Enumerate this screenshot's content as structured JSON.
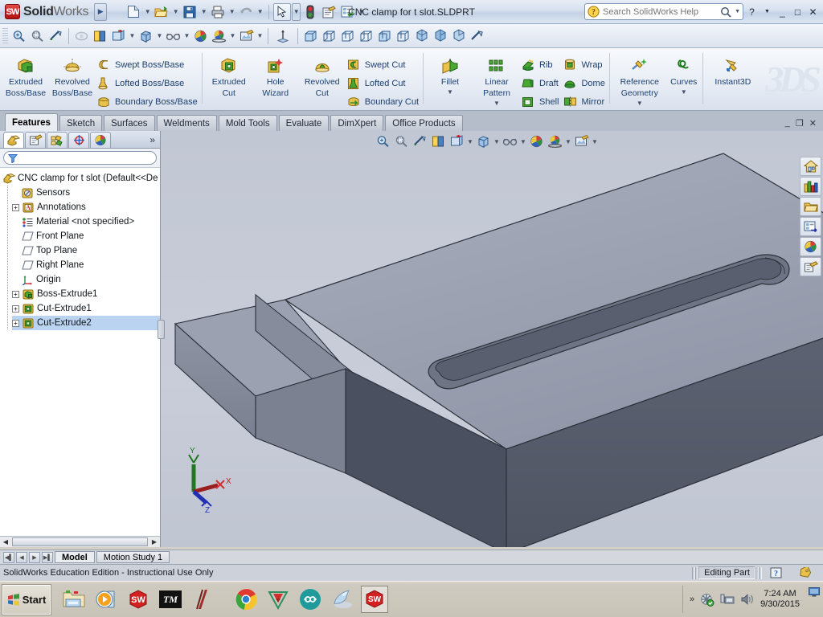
{
  "titlebar": {
    "brand_bold": "Solid",
    "brand_light": "Works",
    "brand_badge": "SW",
    "document_title": "CNC clamp for t slot.SLDPRT",
    "quick_access": [
      {
        "name": "new-document-icon",
        "label": "New"
      },
      {
        "name": "open-document-icon",
        "label": "Open"
      },
      {
        "name": "save-icon",
        "label": "Save"
      },
      {
        "name": "print-icon",
        "label": "Print"
      },
      {
        "name": "undo-icon",
        "label": "Undo"
      },
      {
        "name": "select-pointer-icon",
        "label": "Select"
      },
      {
        "name": "rebuild-icon",
        "label": "Rebuild"
      },
      {
        "name": "options-icon",
        "label": "Options"
      },
      {
        "name": "settings-list-icon",
        "label": "Settings"
      }
    ],
    "search_placeholder": "Search SolidWorks Help",
    "search_value": "",
    "help_label": "?",
    "minimize_label": "_",
    "maximize_label": "□",
    "close_label": "✕"
  },
  "view_toolbar": {
    "items": [
      {
        "name": "zoom-to-fit-icon",
        "label": "Zoom to Fit"
      },
      {
        "name": "zoom-to-area-icon",
        "label": "Zoom to Area"
      },
      {
        "name": "previous-view-icon",
        "label": "Previous View"
      },
      {
        "name": "section-view-icon",
        "label": "Section View"
      },
      {
        "name": "view-orientation-icon",
        "label": "View Orientation"
      },
      {
        "name": "display-style-icon",
        "label": "Display Style"
      },
      {
        "name": "hide-show-items-icon",
        "label": "Hide/Show Items"
      },
      {
        "name": "edit-appearance-icon",
        "label": "Edit Appearance"
      },
      {
        "name": "apply-scene-icon",
        "label": "Apply Scene"
      },
      {
        "name": "view-settings-icon",
        "label": "View Settings"
      },
      {
        "name": "coordinate-triad-icon",
        "label": "Coordinate System"
      }
    ],
    "orientation_views": [
      {
        "name": "view-front-icon",
        "label": "Front"
      },
      {
        "name": "view-back-icon",
        "label": "Back"
      },
      {
        "name": "view-left-icon",
        "label": "Left"
      },
      {
        "name": "view-right-icon",
        "label": "Right"
      },
      {
        "name": "view-top-icon",
        "label": "Top"
      },
      {
        "name": "view-bottom-icon",
        "label": "Bottom"
      },
      {
        "name": "view-isometric-icon",
        "label": "Isometric"
      },
      {
        "name": "view-trimetric-icon",
        "label": "Trimetric"
      },
      {
        "name": "view-dimetric-icon",
        "label": "Dimetric"
      },
      {
        "name": "view-normal-to-icon",
        "label": "Normal To"
      }
    ]
  },
  "ribbon": {
    "groups": [
      {
        "name": "boss-base-group",
        "big": [
          {
            "label_line1": "Extruded",
            "label_line2": "Boss/Base",
            "icon": "extruded-boss-icon",
            "dropdown": false
          },
          {
            "label_line1": "Revolved",
            "label_line2": "Boss/Base",
            "icon": "revolved-boss-icon",
            "dropdown": false
          }
        ],
        "small": [
          {
            "label": "Swept Boss/Base",
            "icon": "swept-boss-icon"
          },
          {
            "label": "Lofted Boss/Base",
            "icon": "lofted-boss-icon"
          },
          {
            "label": "Boundary Boss/Base",
            "icon": "boundary-boss-icon"
          }
        ]
      },
      {
        "name": "cut-group",
        "big": [
          {
            "label_line1": "Extruded",
            "label_line2": "Cut",
            "icon": "extruded-cut-icon",
            "dropdown": false
          },
          {
            "label_line1": "Hole",
            "label_line2": "Wizard",
            "icon": "hole-wizard-icon",
            "dropdown": false
          },
          {
            "label_line1": "Revolved",
            "label_line2": "Cut",
            "icon": "revolved-cut-icon",
            "dropdown": false
          }
        ],
        "small": [
          {
            "label": "Swept Cut",
            "icon": "swept-cut-icon"
          },
          {
            "label": "Lofted Cut",
            "icon": "lofted-cut-icon"
          },
          {
            "label": "Boundary Cut",
            "icon": "boundary-cut-icon"
          }
        ]
      },
      {
        "name": "feature-group",
        "big": [
          {
            "label_line1": "Fillet",
            "label_line2": "",
            "icon": "fillet-icon",
            "dropdown": true
          },
          {
            "label_line1": "Linear",
            "label_line2": "Pattern",
            "icon": "linear-pattern-icon",
            "dropdown": true
          }
        ],
        "small": [
          {
            "label": "Rib",
            "icon": "rib-icon"
          },
          {
            "label": "Draft",
            "icon": "draft-icon"
          },
          {
            "label": "Shell",
            "icon": "shell-icon"
          }
        ],
        "small2": [
          {
            "label": "Wrap",
            "icon": "wrap-icon"
          },
          {
            "label": "Dome",
            "icon": "dome-icon"
          },
          {
            "label": "Mirror",
            "icon": "mirror-icon"
          }
        ]
      },
      {
        "name": "reference-group",
        "big": [
          {
            "label_line1": "Reference",
            "label_line2": "Geometry",
            "icon": "reference-geometry-icon",
            "dropdown": true
          },
          {
            "label_line1": "Curves",
            "label_line2": "",
            "icon": "curves-icon",
            "dropdown": true
          }
        ],
        "small": []
      },
      {
        "name": "instant3d-group",
        "big": [
          {
            "label_line1": "Instant3D",
            "label_line2": "",
            "icon": "instant3d-icon",
            "dropdown": false
          }
        ],
        "small": []
      }
    ],
    "brand_watermark": "3DS"
  },
  "command_tabs": {
    "items": [
      {
        "label": "Features",
        "active": true
      },
      {
        "label": "Sketch",
        "active": false
      },
      {
        "label": "Surfaces",
        "active": false
      },
      {
        "label": "Weldments",
        "active": false
      },
      {
        "label": "Mold Tools",
        "active": false
      },
      {
        "label": "Evaluate",
        "active": false
      },
      {
        "label": "DimXpert",
        "active": false
      },
      {
        "label": "Office Products",
        "active": false
      }
    ],
    "window_controls": {
      "minimize": "_",
      "restore": "❐",
      "close": "✕"
    }
  },
  "manager_panel": {
    "tabs": [
      {
        "name": "feature-manager-tab",
        "icon": "feature-tree-icon",
        "selected": true
      },
      {
        "name": "property-manager-tab",
        "icon": "property-manager-icon",
        "selected": false
      },
      {
        "name": "configuration-manager-tab",
        "icon": "configuration-manager-icon",
        "selected": false
      },
      {
        "name": "dimxpert-manager-tab",
        "icon": "dimxpert-icon",
        "selected": false
      },
      {
        "name": "display-manager-tab",
        "icon": "display-manager-icon",
        "selected": false
      }
    ],
    "more_label": "»",
    "filter_placeholder": "",
    "tree": {
      "root": "CNC clamp for t slot  (Default<<De",
      "nodes": [
        {
          "label": "Sensors",
          "icon": "sensors-icon",
          "expandable": false
        },
        {
          "label": "Annotations",
          "icon": "annotations-icon",
          "expandable": true
        },
        {
          "label": "Material <not specified>",
          "icon": "material-icon",
          "expandable": false
        },
        {
          "label": "Front Plane",
          "icon": "plane-icon",
          "expandable": false
        },
        {
          "label": "Top Plane",
          "icon": "plane-icon",
          "expandable": false
        },
        {
          "label": "Right Plane",
          "icon": "plane-icon",
          "expandable": false
        },
        {
          "label": "Origin",
          "icon": "origin-icon",
          "expandable": false
        },
        {
          "label": "Boss-Extrude1",
          "icon": "boss-extrude-icon",
          "expandable": true
        },
        {
          "label": "Cut-Extrude1",
          "icon": "cut-extrude-icon",
          "expandable": true
        },
        {
          "label": "Cut-Extrude2",
          "icon": "cut-extrude-icon",
          "expandable": true,
          "highlighted": true
        }
      ]
    }
  },
  "graphics_toolbar": {
    "items": [
      {
        "name": "zoom-to-fit-icon",
        "label": "Zoom to Fit"
      },
      {
        "name": "zoom-to-area-icon",
        "label": "Zoom to Area"
      },
      {
        "name": "previous-view-icon",
        "label": "Previous View"
      },
      {
        "name": "section-view-icon",
        "label": "Section View"
      },
      {
        "name": "view-orientation-icon",
        "label": "View Orientation"
      },
      {
        "name": "display-style-icon",
        "label": "Display Style"
      },
      {
        "name": "hide-show-items-icon",
        "label": "Hide/Show Items"
      },
      {
        "name": "edit-appearance-icon",
        "label": "Edit Appearance"
      },
      {
        "name": "apply-scene-icon",
        "label": "Apply Scene"
      },
      {
        "name": "view-settings-icon",
        "label": "View Settings"
      }
    ]
  },
  "task_pane": {
    "buttons": [
      {
        "name": "solidworks-resources-button",
        "icon": "home-icon",
        "label": "SolidWorks Resources"
      },
      {
        "name": "design-library-button",
        "icon": "design-library-icon",
        "label": "Design Library"
      },
      {
        "name": "file-explorer-button",
        "icon": "folder-icon",
        "label": "File Explorer"
      },
      {
        "name": "search-button",
        "icon": "search-panel-icon",
        "label": "Search"
      },
      {
        "name": "view-palette-button",
        "icon": "appearances-icon",
        "label": "Appearances, Scenes and Decals"
      },
      {
        "name": "custom-properties-button",
        "icon": "custom-properties-icon",
        "label": "Custom Properties"
      }
    ]
  },
  "model": {
    "axis_labels": {
      "x": "X",
      "y": "Y",
      "z": "Z"
    },
    "face_colors": {
      "top": "#9aa0b0",
      "front": "#5a6070",
      "side": "#4e5462",
      "slot_inner": "#6e7484",
      "slot_floor": "#50566a",
      "step_top": "#a3a9b8",
      "background_top": "#c2c7d4",
      "background_bottom": "#c0c5d2"
    }
  },
  "bottom_tabs": {
    "nav": [
      "◀▏",
      "◀",
      "▶",
      "▶▕"
    ],
    "tabs": [
      {
        "label": "Model",
        "active": true
      },
      {
        "label": "Motion Study 1",
        "active": false
      }
    ]
  },
  "statusbar": {
    "message": "SolidWorks Education Edition - Instructional Use Only",
    "mode": "Editing Part",
    "help_icon": "?",
    "tag_icon": "tag-icon"
  },
  "taskbar": {
    "start_label": "Start",
    "start_icon": "windows-flag-icon",
    "quick_launch": [
      {
        "name": "file-explorer-taskbar-icon",
        "label": "File Explorer"
      },
      {
        "name": "media-player-taskbar-icon",
        "label": "Media Player"
      },
      {
        "name": "solidworks-taskbar-icon",
        "label": "SolidWorks"
      },
      {
        "name": "teamviewer-taskbar-icon",
        "label": "TeamViewer"
      },
      {
        "name": "app-red-taskbar-icon",
        "label": "Application"
      },
      {
        "name": "chrome-taskbar-icon",
        "label": "Google Chrome"
      },
      {
        "name": "vray-taskbar-icon",
        "label": "V-Ray"
      },
      {
        "name": "arduino-taskbar-icon",
        "label": "Arduino"
      },
      {
        "name": "dolphin-taskbar-icon",
        "label": "Dolphin"
      },
      {
        "name": "solidworks-active-taskbar-icon",
        "label": "SolidWorks"
      }
    ],
    "tray": {
      "expand": "»",
      "icons": [
        {
          "name": "antivirus-tray-icon",
          "label": "Antivirus"
        },
        {
          "name": "network-tray-icon",
          "label": "Network"
        },
        {
          "name": "volume-tray-icon",
          "label": "Volume"
        }
      ],
      "time": "7:24 AM",
      "date": "9/30/2015"
    }
  }
}
